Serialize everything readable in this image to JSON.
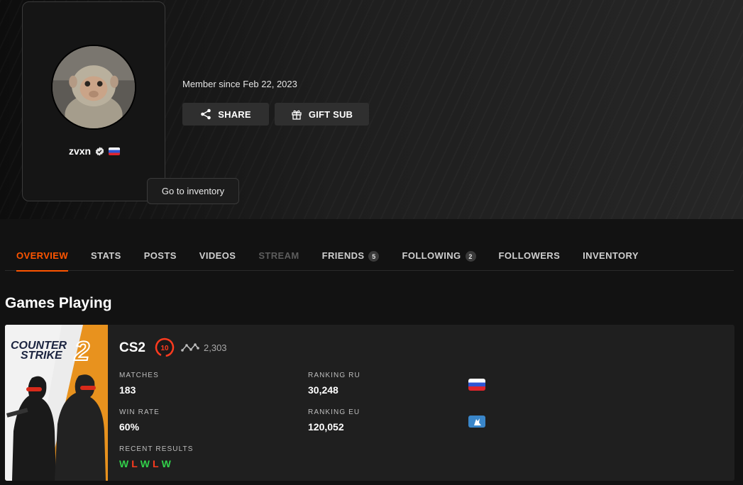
{
  "profile": {
    "username": "zvxn",
    "member_since": "Member since Feb 22, 2023",
    "tooltip": "Go to inventory",
    "share_label": "SHARE",
    "gift_label": "GIFT SUB"
  },
  "tabs": [
    {
      "label": "OVERVIEW",
      "state": "active"
    },
    {
      "label": "STATS"
    },
    {
      "label": "POSTS"
    },
    {
      "label": "VIDEOS"
    },
    {
      "label": "STREAM",
      "state": "disabled"
    },
    {
      "label": "FRIENDS",
      "badge": "5"
    },
    {
      "label": "FOLLOWING",
      "badge": "2"
    },
    {
      "label": "FOLLOWERS"
    },
    {
      "label": "INVENTORY"
    }
  ],
  "section_title": "Games Playing",
  "game": {
    "art_line1": "COUNTER",
    "art_line2": "STRIKE",
    "art_number": "2",
    "name": "CS2",
    "level": "10",
    "elo": "2,303",
    "matches_label": "MATCHES",
    "matches": "183",
    "win_rate_label": "WIN RATE",
    "win_rate": "60%",
    "ranking_ru_label": "RANKING RU",
    "ranking_ru": "30,248",
    "ranking_eu_label": "RANKING EU",
    "ranking_eu": "120,052",
    "recent_results_label": "RECENT RESULTS",
    "recent_results": [
      "W",
      "L",
      "W",
      "L",
      "W"
    ]
  },
  "colors": {
    "accent": "#ff5500",
    "win": "#32d14b",
    "loss": "#ff3b1f",
    "eu_badge": "#3a86c9"
  },
  "icons": {
    "share": "share-icon",
    "gift": "gift-icon",
    "verified": "verified-icon",
    "level": "level-10-icon",
    "elo": "elo-icon"
  }
}
